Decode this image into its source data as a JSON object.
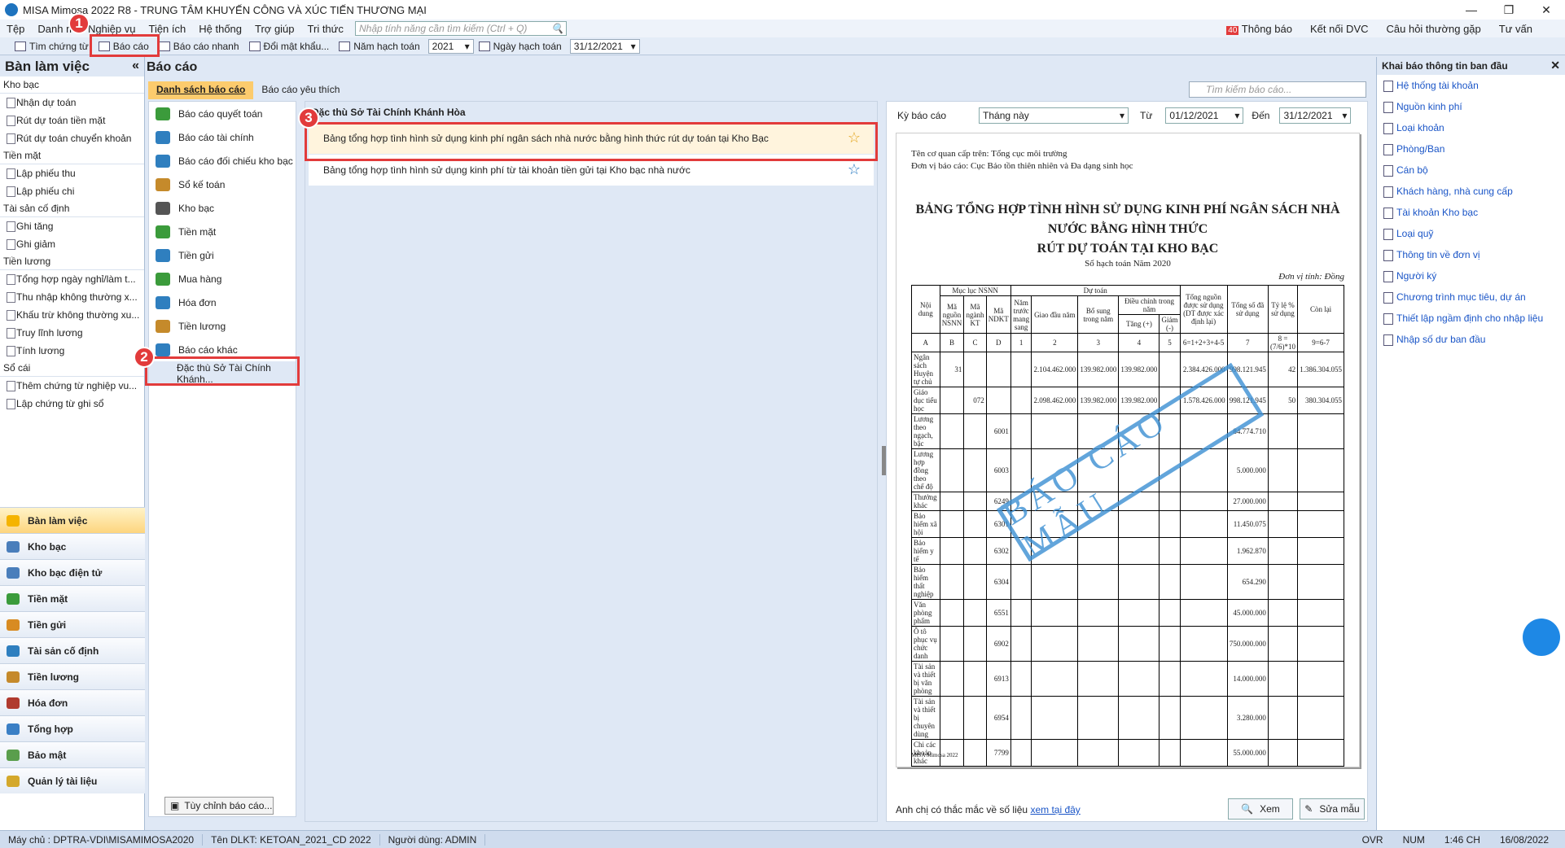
{
  "window": {
    "title": "MISA Mimosa 2022 R8 - TRUNG TÂM KHUYẾN CÔNG VÀ XÚC TIẾN THƯƠNG MẠI"
  },
  "menu": {
    "items": [
      "Tệp",
      "Danh m",
      "Nghiệp vụ",
      "Tiện ích",
      "Hệ thống",
      "Trợ giúp",
      "Tri thức"
    ],
    "search_placeholder": "Nhập tính năng cần tìm kiếm (Ctrl + Q)",
    "notif_count": "40",
    "notif_label": "Thông báo",
    "dvc": "Kết nối DVC",
    "faq": "Câu hỏi thường gặp",
    "consult": "Tư vấn"
  },
  "toolbar": {
    "find": "Tìm chứng từ",
    "report": "Báo cáo",
    "quick_report": "Báo cáo nhanh",
    "change_pw": "Đổi mật khẩu...",
    "fiscal_year_label": "Năm hạch toán",
    "fiscal_year": "2021",
    "acct_date_label": "Ngày hạch toán",
    "acct_date": "31/12/2021"
  },
  "left": {
    "title": "Bàn làm việc",
    "collapse": "«",
    "groups": [
      {
        "name": "Kho bạc",
        "items": [
          "Nhận dự toán",
          "Rút dự toán tiền mặt",
          "Rút dự toán chuyển khoản"
        ]
      },
      {
        "name": "Tiền mặt",
        "items": [
          "Lập phiếu thu",
          "Lập phiếu chi"
        ]
      },
      {
        "name": "Tài sản cố định",
        "items": [
          "Ghi tăng",
          "Ghi giảm"
        ]
      },
      {
        "name": "Tiền lương",
        "items": [
          "Tổng hợp ngày nghỉ/làm t...",
          "Thu nhập không thường x...",
          "Khấu trừ không thường xu...",
          "Truy lĩnh lương",
          "Tính lương"
        ]
      },
      {
        "name": "Sổ cái",
        "items": [
          "Thêm chứng từ nghiệp vu...",
          "Lập chứng từ ghi sổ"
        ]
      }
    ],
    "nav": [
      "Bàn làm việc",
      "Kho bạc",
      "Kho bạc điện tử",
      "Tiền mặt",
      "Tiền gửi",
      "Tài sản cố định",
      "Tiền lương",
      "Hóa đơn",
      "Tổng hợp",
      "Bảo mật",
      "Quản lý tài liệu"
    ]
  },
  "reports": {
    "title": "Báo cáo",
    "tab_list": "Danh sách báo cáo",
    "tab_fav": "Báo cáo yêu thích",
    "search_placeholder": "Tìm kiếm báo cáo...",
    "categories": [
      "Báo cáo quyết toán",
      "Báo cáo tài chính",
      "Báo cáo đối chiếu kho bạc",
      "Sổ kế toán",
      "Kho bạc",
      "Tiền mặt",
      "Tiền gửi",
      "Mua hàng",
      "Hóa đơn",
      "Tiền lương",
      "Báo cáo khác",
      "Đặc thù Sở Tài Chính Khánh..."
    ],
    "custom_btn": "Tùy chỉnh báo cáo...",
    "group_heading": "Đặc thù Sở Tài Chính Khánh Hòa",
    "items": [
      "Bảng tổng hợp tình hình sử dụng kinh phí ngân sách nhà nước bằng hình thức rút dự toán tại Kho Bạc",
      "Bảng tổng hợp tình hình sử dụng kinh phí từ tài khoản tiền gửi tại Kho bạc nhà nước"
    ]
  },
  "preview": {
    "period_label": "Kỳ báo cáo",
    "period": "Tháng này",
    "from_label": "Từ",
    "from": "01/12/2021",
    "to_label": "Đến",
    "to": "31/12/2021",
    "meta1": "Tên cơ quan cấp trên: Tổng cục môi trường",
    "meta2": "Đơn vị báo cáo: Cục Bảo tồn thiên nhiên và Đa dạng sinh học",
    "title1": "BẢNG TỔNG HỢP TÌNH HÌNH SỬ DỤNG KINH PHÍ NGÂN SÁCH NHÀ NƯỚC BẰNG HÌNH THỨC",
    "title2": "RÚT DỰ TOÁN TẠI KHO BẠC",
    "subtitle": "Sổ hạch toán Năm 2020",
    "unit": "Đơn vị tính: Đồng",
    "stamp": "BÁO CÁO MẪU",
    "footer": "MISA Mimosa 2022",
    "question": "Anh chị có thắc mắc về số liệu",
    "link": "xem tại đây",
    "view_btn": "Xem",
    "edit_btn": "Sửa mẫu",
    "table": {
      "h": [
        "Nội dung",
        "Mục lục NSNN",
        "Dự toán",
        "Tổng nguồn được sử dụng (DT được xác định lại)",
        "Tổng số đã sử dụng",
        "Tỷ lệ % sử dụng",
        "Còn lại"
      ],
      "sub": [
        "Mã nguồn NSNN",
        "Mã ngành KT",
        "Mã NDKT",
        "Năm trước mang sang",
        "Giao đầu năm",
        "Bổ sung trong năm",
        "Điều chỉnh trong năm",
        "Tăng (+)",
        "Giảm (-)"
      ],
      "codes": [
        "A",
        "B",
        "C",
        "D",
        "1",
        "2",
        "3",
        "4",
        "5",
        "6=1+2+3+4-5",
        "7",
        "8 = (7/6)*10",
        "9=6-7"
      ],
      "rows": [
        [
          "Ngân sách Huyện tự chủ",
          "31",
          "",
          "",
          "",
          "2.104.462.000",
          "139.982.000",
          "139.982.000",
          "",
          "2.384.426.000",
          "998.121.945",
          "42",
          "1.386.304.055"
        ],
        [
          "Giáo dục tiểu học",
          "",
          "072",
          "",
          "",
          "2.098.462.000",
          "139.982.000",
          "139.982.000",
          "",
          "1.578.426.000",
          "998.121.945",
          "50",
          "380.304.055"
        ],
        [
          "Lương theo ngạch, bậc",
          "",
          "",
          "6001",
          "",
          "",
          "",
          "",
          "",
          "",
          "84.774.710",
          "",
          ""
        ],
        [
          "Lương hợp đồng theo chế độ",
          "",
          "",
          "6003",
          "",
          "",
          "",
          "",
          "",
          "",
          "5.000.000",
          "",
          ""
        ],
        [
          "Thưởng khác",
          "",
          "",
          "6249",
          "",
          "",
          "",
          "",
          "",
          "",
          "27.000.000",
          "",
          ""
        ],
        [
          "Bảo hiểm xã hội",
          "",
          "",
          "6301",
          "",
          "",
          "",
          "",
          "",
          "",
          "11.450.075",
          "",
          ""
        ],
        [
          "Bảo hiểm y tế",
          "",
          "",
          "6302",
          "",
          "",
          "",
          "",
          "",
          "",
          "1.962.870",
          "",
          ""
        ],
        [
          "Bảo hiểm thất nghiệp",
          "",
          "",
          "6304",
          "",
          "",
          "",
          "",
          "",
          "",
          "654.290",
          "",
          ""
        ],
        [
          "Văn phòng phẩm",
          "",
          "",
          "6551",
          "",
          "",
          "",
          "",
          "",
          "",
          "45.000.000",
          "",
          ""
        ],
        [
          "Ô tô phục vụ chức danh",
          "",
          "",
          "6902",
          "",
          "",
          "",
          "",
          "",
          "",
          "750.000.000",
          "",
          ""
        ],
        [
          "Tài sản và thiết bị văn phòng",
          "",
          "",
          "6913",
          "",
          "",
          "",
          "",
          "",
          "",
          "14.000.000",
          "",
          ""
        ],
        [
          "Tài sản và thiết bị chuyên dùng",
          "",
          "",
          "6954",
          "",
          "",
          "",
          "",
          "",
          "",
          "3.280.000",
          "",
          ""
        ],
        [
          "Chi các khoản khác",
          "",
          "",
          "7799",
          "",
          "",
          "",
          "",
          "",
          "",
          "55.000.000",
          "",
          ""
        ]
      ]
    }
  },
  "right": {
    "title": "Khai báo thông tin ban đầu",
    "links": [
      "Hệ thống tài khoản",
      "Nguồn kinh phí",
      "Loại khoản",
      "Phòng/Ban",
      "Cán bộ",
      "Khách hàng, nhà cung cấp",
      "Tài khoản Kho bạc",
      "Loại quỹ",
      "Thông tin về đơn vị",
      "Người ký",
      "Chương trình mục tiêu, dự án",
      "Thiết lập ngầm định cho nhập liệu",
      "Nhập số dư ban đầu"
    ]
  },
  "status": {
    "server": "Máy chủ : DPTRA-VDI\\MISAMIMOSA2020",
    "db": "Tên DLKT: KETOAN_2021_CD 2022",
    "user": "Người dùng: ADMIN",
    "ovr": "OVR",
    "num": "NUM",
    "time": "1:46 CH",
    "date": "16/08/2022"
  },
  "annotations": [
    "1",
    "2",
    "3"
  ]
}
